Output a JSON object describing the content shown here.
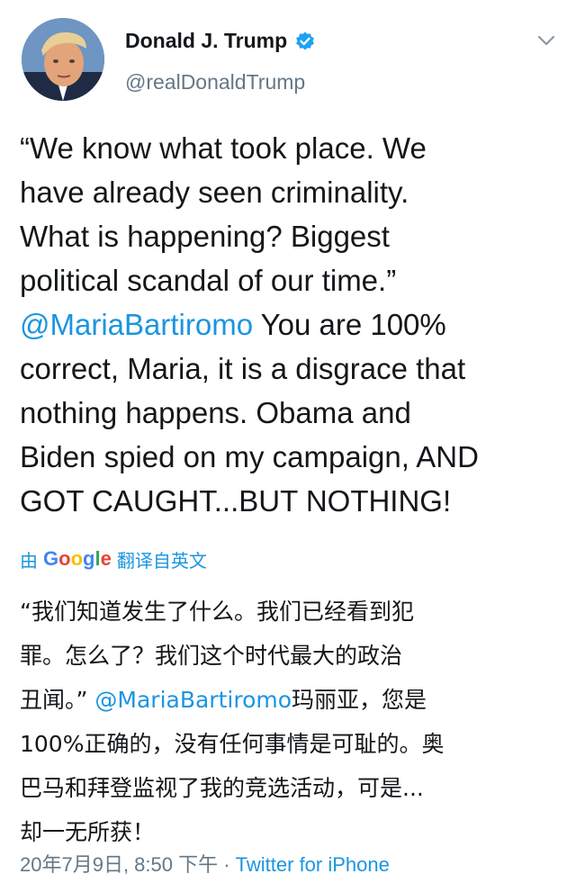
{
  "author": {
    "name": "Donald J. Trump",
    "handle": "@realDonaldTrump"
  },
  "tweet": {
    "lines": [
      {
        "text": "“We know what took place. We"
      },
      {
        "text": "have already seen criminality."
      },
      {
        "text": "What is happening? Biggest"
      },
      {
        "text": "political scandal of our time.”"
      },
      {
        "mention": "@MariaBartiromo",
        "text": " You are 100%"
      },
      {
        "text": "correct, Maria, it is a disgrace that"
      },
      {
        "text": "nothing happens. Obama and"
      },
      {
        "text": "Biden spied on my campaign, AND"
      },
      {
        "text": "GOT CAUGHT...BUT NOTHING!"
      }
    ]
  },
  "translation": {
    "prefix": "由",
    "provider": "Google",
    "suffix": "翻译自英文",
    "lines": [
      {
        "text": "“我们知道发生了什么。我们已经看到犯"
      },
      {
        "text": "罪。怎么了？我们这个时代最大的政治"
      },
      {
        "text": "丑闻。” ",
        "mention": "@MariaBartiromo",
        "text_after": "玛丽亚，您是"
      },
      {
        "text": "100%正确的，没有任何事情是可耻的。奥"
      },
      {
        "text": "巴马和拜登监视了我的竞选活动，可是..."
      },
      {
        "text": "却一无所获！"
      }
    ]
  },
  "meta": {
    "timestamp": "20年7月9日, 8:50 下午",
    "separator": " · ",
    "source": "Twitter for iPhone"
  },
  "icons": {
    "verified": "verified-badge-icon",
    "menu": "chevron-down-icon",
    "verified_color": "#1da1f2",
    "link_color": "#1b95e0"
  }
}
